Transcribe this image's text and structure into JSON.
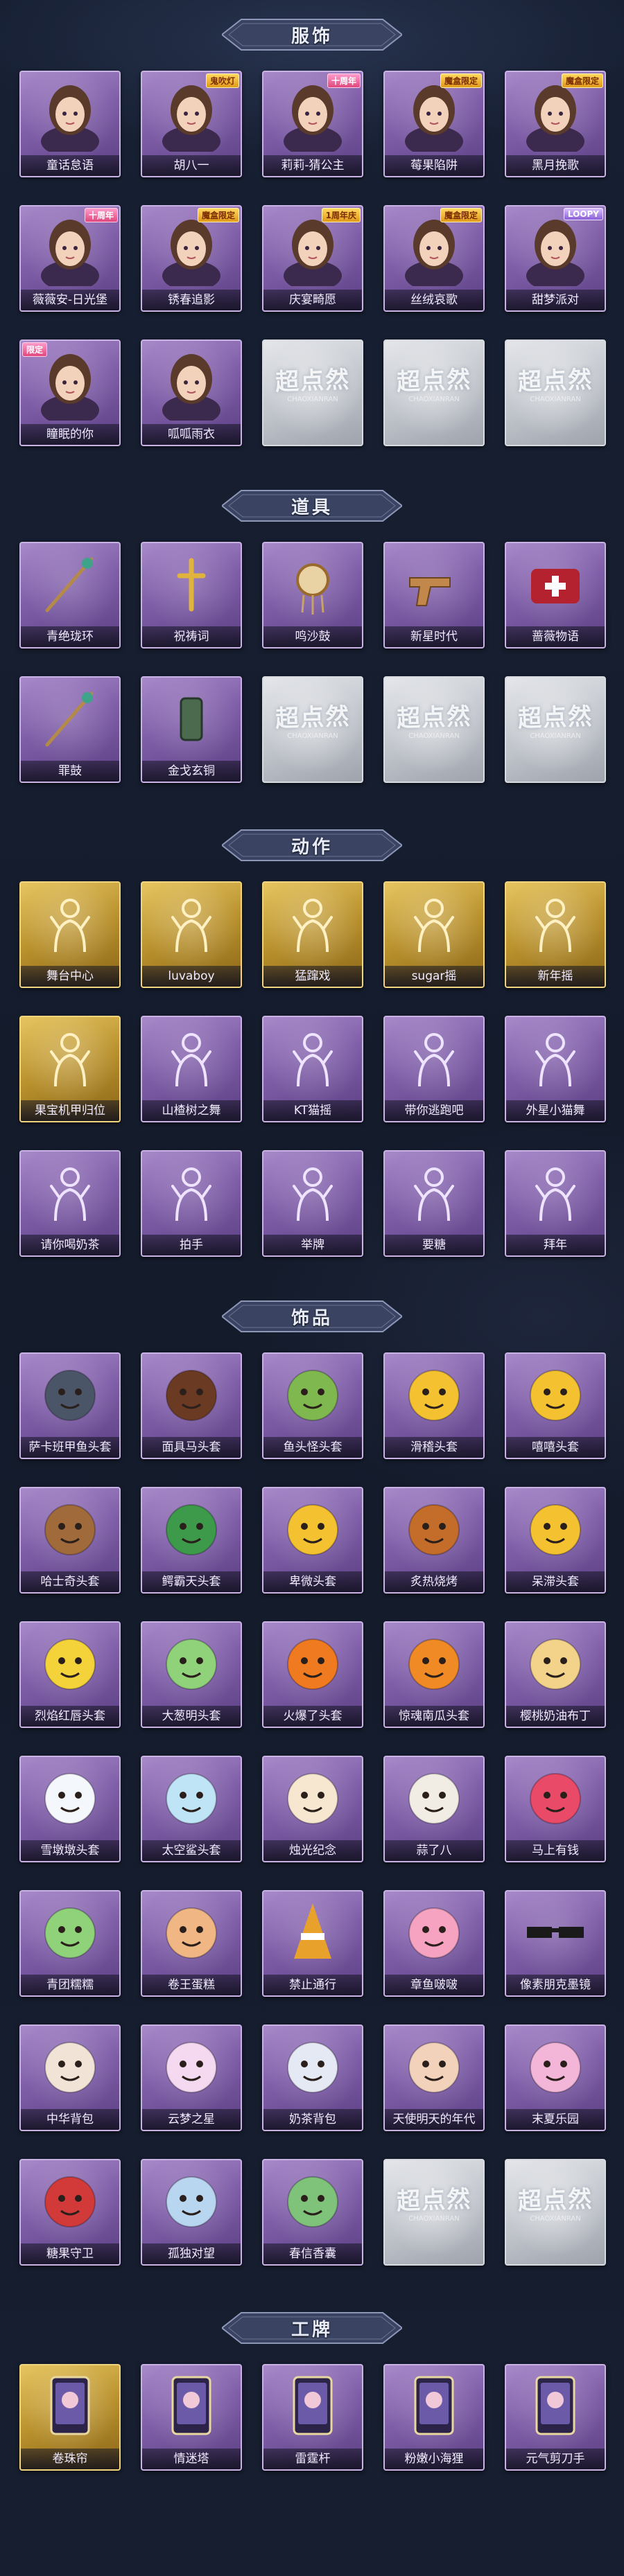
{
  "sections": [
    {
      "title": "服饰",
      "items": [
        {
          "label": "童话怠语",
          "style": "purple",
          "icon": "portrait-icon",
          "badge": ""
        },
        {
          "label": "胡八一",
          "style": "purple",
          "icon": "portrait-icon",
          "badge": "鬼吹灯"
        },
        {
          "label": "莉莉-猜公主",
          "style": "purple",
          "icon": "portrait-icon",
          "badge": "十周年"
        },
        {
          "label": "莓果陷阱",
          "style": "purple",
          "icon": "portrait-icon",
          "badge": "魔盒限定"
        },
        {
          "label": "黑月挽歌",
          "style": "purple",
          "icon": "portrait-icon",
          "badge": "魔盒限定"
        },
        {
          "label": "薇薇安-日光堡",
          "style": "purple",
          "icon": "portrait-icon",
          "badge": "十周年"
        },
        {
          "label": "锈春追影",
          "style": "purple",
          "icon": "portrait-icon",
          "badge": "魔盒限定"
        },
        {
          "label": "庆宴畸愿",
          "style": "purple",
          "icon": "portrait-icon",
          "badge": "1周年庆"
        },
        {
          "label": "丝绒哀歌",
          "style": "purple",
          "icon": "portrait-icon",
          "badge": "魔盒限定"
        },
        {
          "label": "甜梦派对",
          "style": "purple",
          "icon": "portrait-icon",
          "badge": "LOOPY"
        },
        {
          "label": "瞳眠的你",
          "style": "purple",
          "icon": "portrait-icon",
          "badge": "限定"
        },
        {
          "label": "呱呱雨衣",
          "style": "purple",
          "icon": "portrait-icon",
          "badge": ""
        },
        {
          "label": "",
          "style": "grey",
          "icon": "",
          "badge": ""
        },
        {
          "label": "",
          "style": "grey",
          "icon": "",
          "badge": ""
        },
        {
          "label": "",
          "style": "grey",
          "icon": "",
          "badge": ""
        }
      ]
    },
    {
      "title": "道具",
      "items": [
        {
          "label": "青绝珑环",
          "style": "purple",
          "icon": "staff-icon",
          "badge": ""
        },
        {
          "label": "祝祷词",
          "style": "purple",
          "icon": "cross-icon",
          "badge": ""
        },
        {
          "label": "鸣沙鼓",
          "style": "purple",
          "icon": "drum-icon",
          "badge": ""
        },
        {
          "label": "新星时代",
          "style": "purple",
          "icon": "revolver-icon",
          "badge": ""
        },
        {
          "label": "蔷薇物语",
          "style": "purple",
          "icon": "medkit-icon",
          "badge": ""
        },
        {
          "label": "罪鼓",
          "style": "purple",
          "icon": "staff-icon",
          "badge": ""
        },
        {
          "label": "金戈玄铜",
          "style": "purple",
          "icon": "lantern-icon",
          "badge": ""
        },
        {
          "label": "",
          "style": "grey",
          "icon": "",
          "badge": ""
        },
        {
          "label": "",
          "style": "grey",
          "icon": "",
          "badge": ""
        },
        {
          "label": "",
          "style": "grey",
          "icon": "",
          "badge": ""
        }
      ]
    },
    {
      "title": "动作",
      "items": [
        {
          "label": "舞台中心",
          "style": "gold",
          "icon": "figure-icon",
          "badge": ""
        },
        {
          "label": "luvaboy",
          "style": "gold",
          "icon": "figure-icon",
          "badge": ""
        },
        {
          "label": "猛蹿戏",
          "style": "gold",
          "icon": "figure-icon",
          "badge": ""
        },
        {
          "label": "sugar摇",
          "style": "gold",
          "icon": "figure-icon",
          "badge": ""
        },
        {
          "label": "新年摇",
          "style": "gold",
          "icon": "figure-icon",
          "badge": ""
        },
        {
          "label": "果宝机甲归位",
          "style": "gold",
          "icon": "figure-icon",
          "badge": ""
        },
        {
          "label": "山楂树之舞",
          "style": "purple",
          "icon": "figure-icon",
          "badge": ""
        },
        {
          "label": "KT猫摇",
          "style": "purple",
          "icon": "figure-icon",
          "badge": ""
        },
        {
          "label": "带你逃跑吧",
          "style": "purple",
          "icon": "figure-icon",
          "badge": ""
        },
        {
          "label": "外星小猫舞",
          "style": "purple",
          "icon": "figure-icon",
          "badge": ""
        },
        {
          "label": "请你喝奶茶",
          "style": "purple",
          "icon": "figure-icon",
          "badge": ""
        },
        {
          "label": "拍手",
          "style": "purple",
          "icon": "figure-icon",
          "badge": ""
        },
        {
          "label": "举牌",
          "style": "purple",
          "icon": "figure-icon",
          "badge": ""
        },
        {
          "label": "要糖",
          "style": "purple",
          "icon": "figure-icon",
          "badge": ""
        },
        {
          "label": "拜年",
          "style": "purple",
          "icon": "figure-icon",
          "badge": ""
        }
      ]
    },
    {
      "title": "饰品",
      "items": [
        {
          "label": "萨卡班甲鱼头套",
          "style": "purple",
          "icon": "fish-head-icon",
          "badge": ""
        },
        {
          "label": "面具马头套",
          "style": "purple",
          "icon": "horse-head-icon",
          "badge": ""
        },
        {
          "label": "鱼头怪头套",
          "style": "purple",
          "icon": "fish-monster-icon",
          "badge": ""
        },
        {
          "label": "滑稽头套",
          "style": "purple",
          "icon": "smiley-icon",
          "badge": ""
        },
        {
          "label": "嘻嘻头套",
          "style": "purple",
          "icon": "grin-icon",
          "badge": ""
        },
        {
          "label": "哈士奇头套",
          "style": "purple",
          "icon": "dog-head-icon",
          "badge": ""
        },
        {
          "label": "鳄霸天头套",
          "style": "purple",
          "icon": "crocodile-icon",
          "badge": ""
        },
        {
          "label": "卑微头套",
          "style": "purple",
          "icon": "sad-face-icon",
          "badge": ""
        },
        {
          "label": "炙热烧烤",
          "style": "purple",
          "icon": "bbq-icon",
          "badge": ""
        },
        {
          "label": "呆滞头套",
          "style": "purple",
          "icon": "stare-face-icon",
          "badge": ""
        },
        {
          "label": "烈焰红唇头套",
          "style": "purple",
          "icon": "pikachu-icon",
          "badge": ""
        },
        {
          "label": "大葱明头套",
          "style": "purple",
          "icon": "scallion-icon",
          "badge": ""
        },
        {
          "label": "火爆了头套",
          "style": "purple",
          "icon": "fire-icon",
          "badge": ""
        },
        {
          "label": "惊魂南瓜头套",
          "style": "purple",
          "icon": "pumpkin-icon",
          "badge": ""
        },
        {
          "label": "樱桃奶油布丁",
          "style": "purple",
          "icon": "pudding-icon",
          "badge": ""
        },
        {
          "label": "雪墩墩头套",
          "style": "purple",
          "icon": "snowman-icon",
          "badge": ""
        },
        {
          "label": "太空鲨头套",
          "style": "purple",
          "icon": "shark-icon",
          "badge": ""
        },
        {
          "label": "烛光纪念",
          "style": "purple",
          "icon": "candle-icon",
          "badge": ""
        },
        {
          "label": "蒜了八",
          "style": "purple",
          "icon": "garlic-icon",
          "badge": ""
        },
        {
          "label": "马上有钱",
          "style": "purple",
          "icon": "horse-money-icon",
          "badge": ""
        },
        {
          "label": "青团糯糯",
          "style": "purple",
          "icon": "green-bun-icon",
          "badge": ""
        },
        {
          "label": "卷王蛋糕",
          "style": "purple",
          "icon": "cake-roll-icon",
          "badge": ""
        },
        {
          "label": "禁止通行",
          "style": "purple",
          "icon": "traffic-cone-icon",
          "badge": ""
        },
        {
          "label": "章鱼啵啵",
          "style": "purple",
          "icon": "octopus-icon",
          "badge": ""
        },
        {
          "label": "像素朋克墨镜",
          "style": "purple",
          "icon": "pixel-glasses-icon",
          "badge": ""
        },
        {
          "label": "中华背包",
          "style": "purple",
          "icon": "backpack-icon",
          "badge": ""
        },
        {
          "label": "云梦之星",
          "style": "purple",
          "icon": "unicorn-icon",
          "badge": ""
        },
        {
          "label": "奶茶背包",
          "style": "purple",
          "icon": "milk-tea-bag-icon",
          "badge": ""
        },
        {
          "label": "天使明天的年代",
          "style": "purple",
          "icon": "angel-icon",
          "badge": ""
        },
        {
          "label": "末夏乐园",
          "style": "purple",
          "icon": "doll-icon",
          "badge": ""
        },
        {
          "label": "糖果守卫",
          "style": "purple",
          "icon": "candy-guard-icon",
          "badge": ""
        },
        {
          "label": "孤独对望",
          "style": "purple",
          "icon": "charm-icon",
          "badge": ""
        },
        {
          "label": "春信香囊",
          "style": "purple",
          "icon": "sachet-icon",
          "badge": ""
        },
        {
          "label": "",
          "style": "grey",
          "icon": "",
          "badge": ""
        },
        {
          "label": "",
          "style": "grey",
          "icon": "",
          "badge": ""
        }
      ]
    },
    {
      "title": "工牌",
      "items": [
        {
          "label": "卷珠帘",
          "style": "gold",
          "icon": "badge-card-icon",
          "badge": ""
        },
        {
          "label": "情迷塔",
          "style": "purple",
          "icon": "badge-card-icon",
          "badge": ""
        },
        {
          "label": "雷霆杆",
          "style": "purple",
          "icon": "badge-card-icon",
          "badge": ""
        },
        {
          "label": "粉嫩小海狸",
          "style": "purple",
          "icon": "badge-card-icon",
          "badge": ""
        },
        {
          "label": "元气剪刀手",
          "style": "purple",
          "icon": "badge-card-icon",
          "badge": ""
        }
      ]
    }
  ],
  "placeholder_watermark": "超点然",
  "placeholder_sub": "CHAOXIANRAN",
  "colors": {
    "background": "#151d2e",
    "card_purple": "#7f5ea8",
    "card_gold": "#b8902c",
    "card_grey": "#bfc3ca"
  }
}
